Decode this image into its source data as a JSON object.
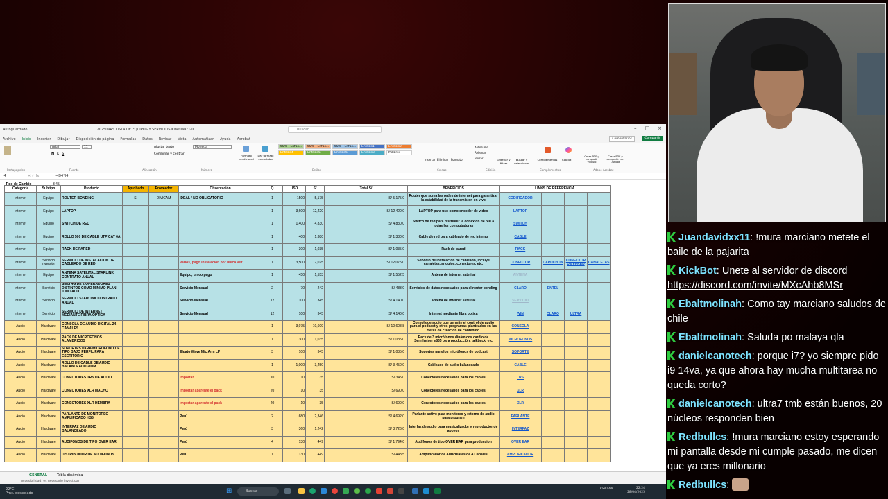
{
  "excel": {
    "autosave_label": "Autoguardado",
    "doc_title": "202509RS LISTA DE EQUIPOS Y SERVICIOS KinesiaRr GIC",
    "search_placeholder": "Buscar",
    "menu": [
      "Archivo",
      "Inicio",
      "Insertar",
      "Dibujar",
      "Disposición de página",
      "Fórmulas",
      "Datos",
      "Revisar",
      "Vista",
      "Automatizar",
      "Ayuda",
      "Acrobat"
    ],
    "comments_label": "Comentarios",
    "share_label": "Compartir",
    "ribbon": {
      "font_name": "Arial",
      "font_size": "11",
      "wrap_text": "Ajustar texto",
      "merge": "Combinar y centrar",
      "number_format": "Moneda",
      "cond_format": "Formato condicional",
      "table_format": "Dar formato como tabla",
      "styles": [
        {
          "label": "60% - Énfas...",
          "color": "#a9d08e"
        },
        {
          "label": "60% - Énfas...",
          "color": "#f4b183"
        },
        {
          "label": "60% - Énfas...",
          "color": "#9dc3e6"
        },
        {
          "label": "Énfasis1",
          "color": "#4472c4"
        },
        {
          "label": "Énfasis2",
          "color": "#ed7d31"
        },
        {
          "label": "Énfasis4",
          "color": "#ffc000"
        },
        {
          "label": "Énfasis5",
          "color": "#70ad47"
        },
        {
          "label": "Énfasis6",
          "color": "#5b9bd5"
        },
        {
          "label": "Énfasis3",
          "color": "#4bacc6"
        },
        {
          "label": "Millares",
          "color": "#ffffff"
        }
      ],
      "insert": "Insertar",
      "delete": "Eliminar",
      "format": "Formato",
      "autosum": "Autosuma",
      "fill": "Rellenar",
      "clear": "Borrar",
      "sort_filter": "Ordenar y filtrar",
      "find_select": "Buscar y seleccionar",
      "addins": "Complementos",
      "copilot": "Copilot",
      "pdf1": "Crear PDF y compartir vínculo",
      "pdf2": "Crear PDF y compartir con Outlook",
      "groups": [
        "Portapapeles",
        "Fuente",
        "Alineación",
        "Número",
        "Estilos",
        "Celdas",
        "Edición",
        "Complementos",
        "Adobe Acrobat"
      ]
    },
    "formula": {
      "cell": "I4",
      "value": "=D4*I4"
    },
    "exchange_label": "Tipo de Cambio",
    "exchange_rate": "3.45",
    "headers": [
      "Categoría",
      "Subtipo",
      "Producto",
      "Aprobado",
      "Proveedor",
      "Observación",
      "Q",
      "USD",
      "S/",
      "Total S/",
      "BENEFICIOS",
      "LINKS DE REFERENCIA"
    ],
    "rows": [
      {
        "cat": "Internet",
        "sub": "Equipo",
        "prod": "ROUTER BONDING",
        "apr": "Si",
        "prov": "DIVICAM",
        "obs": "IDEAL / NO OBLIGATORIO",
        "q": "1",
        "usd": "1500",
        "sol": "5,175",
        "total": "S/ 5,175.0",
        "ben": "Router que suma las redes de internet para garantizar la estabilidad de la transmision en vivo",
        "l1": "CODIFICADOR",
        "l2": "",
        "l3": "",
        "l4": ""
      },
      {
        "cat": "Internet",
        "sub": "Equipo",
        "prod": "LAPTOP",
        "apr": "",
        "prov": "",
        "obs": "",
        "q": "1",
        "usd": "3,600",
        "sol": "12,420",
        "total": "S/ 12,420.0",
        "ben": "LAPTOP para uso como encoder de video",
        "l1": "LAPTOP",
        "l2": "",
        "l3": "",
        "l4": ""
      },
      {
        "cat": "Internet",
        "sub": "Equipo",
        "prod": "SWITCH DE RED",
        "apr": "",
        "prov": "",
        "obs": "",
        "q": "1",
        "usd": "1,400",
        "sol": "4,830",
        "total": "S/ 4,830.0",
        "ben": "Switch de red para distribuir la conexión de red a todas las computadoras",
        "l1": "SWITCH",
        "l2": "",
        "l3": "",
        "l4": ""
      },
      {
        "cat": "Internet",
        "sub": "Equipo",
        "prod": "ROLLO 500 DE CABLE UTP CAT 6A",
        "apr": "",
        "prov": "",
        "obs": "",
        "q": "1",
        "usd": "400",
        "sol": "1,380",
        "total": "S/ 1,380.0",
        "ben": "Cable de red para cableado de red interno",
        "l1": "CABLE",
        "l2": "",
        "l3": "",
        "l4": ""
      },
      {
        "cat": "Internet",
        "sub": "Equipo",
        "prod": "RACK DE PARED",
        "apr": "",
        "prov": "",
        "obs": "",
        "q": "1",
        "usd": "300",
        "sol": "1,035",
        "total": "S/ 1,035.0",
        "ben": "Rack de pared",
        "l1": "RACK",
        "l2": "",
        "l3": "",
        "l4": ""
      },
      {
        "cat": "Internet",
        "sub": "Servicio Inversión",
        "prod": "SERVICIO DE INSTALACION DE CABLEADO DE RED",
        "apr": "",
        "prov": "",
        "obs": "Varios, pago instalacion por unica vez",
        "obs_red": true,
        "q": "1",
        "usd": "3,500",
        "sol": "12,075",
        "total": "S/ 12,075.0",
        "ben": "Servicio de instalacion de cableado, incluye canaletas, angulos, conectores, etc.",
        "l1": "CONECTOR",
        "l2": "CAPUCHON",
        "l3": "CONECTOR DE PARED",
        "l4": "CANALETAS"
      },
      {
        "cat": "Internet",
        "sub": "Equipo",
        "prod": "ANTENA SATELITAL STARLINK CONTRATO ANUAL",
        "apr": "",
        "prov": "",
        "obs": "Equipo, unico pago",
        "q": "1",
        "usd": "450",
        "sol": "1,553",
        "total": "S/ 1,552.5",
        "ben": "Antena de internet satelital",
        "l1": "ANTENA",
        "l2": "",
        "l3": "",
        "l4": "",
        "l1_faint": true
      },
      {
        "cat": "Internet",
        "sub": "Servicio",
        "prod": "SIMS 4G DE 2 OPERADORES DISTINTOS COMO MINIMO PLAN ILIMITADO",
        "apr": "",
        "prov": "",
        "obs": "Servicio Mensual",
        "q": "2",
        "usd": "70",
        "sol": "242",
        "total": "S/ 483.0",
        "ben": "Servicios de datos necesarios para el router bonding",
        "l1": "CLARO",
        "l2": "ENTEL",
        "l3": "",
        "l4": ""
      },
      {
        "cat": "Internet",
        "sub": "Servicio",
        "prod": "SERVICIO STARLINK CONTRATO ANUAL",
        "apr": "",
        "prov": "",
        "obs": "Servicio Mensual",
        "q": "12",
        "usd": "100",
        "sol": "345",
        "total": "S/ 4,140.0",
        "ben": "Antena de internet satelital",
        "l1": "SERVICIO",
        "l2": "",
        "l3": "",
        "l4": "",
        "l1_faint": true
      },
      {
        "cat": "Internet",
        "sub": "Servicio",
        "prod": "SERVICIO DE INTERNET MEDIANTE FIBRA OPTICA",
        "apr": "",
        "prov": "",
        "obs": "Servicio Mensual",
        "q": "12",
        "usd": "100",
        "sol": "345",
        "total": "S/ 4,140.0",
        "ben": "Internet mediante fibra optica",
        "l1": "WIN",
        "l2": "CLARO",
        "l3": "ULTRA",
        "l4": ""
      },
      {
        "cat": "Audio",
        "sub": "Hardware",
        "prod": "CONSOLA DE AUDIO DIGITAL 24 CANALES",
        "apr": "",
        "prov": "",
        "obs": "",
        "q": "1",
        "usd": "3,075",
        "sol": "10,609",
        "total": "S/ 10,608.8",
        "ben": "Consola de audio que permite el control de audio para el podcast y otros programas planteados en las metas de creación de contenido.",
        "l1": "CONSOLA",
        "l2": "",
        "l3": "",
        "l4": ""
      },
      {
        "cat": "Audio",
        "sub": "Hardware",
        "prod": "PACK DE MICROFONOS ALAMBRICOS",
        "apr": "",
        "prov": "",
        "obs": "",
        "q": "1",
        "usd": "300",
        "sol": "1,035",
        "total": "S/ 1,035.0",
        "ben": "Pack de 3 micrófonos dinámicos cardioide Sennheiser e835 para producción, talkback, etc",
        "l1": "MICROFONOS",
        "l2": "",
        "l3": "",
        "l4": ""
      },
      {
        "cat": "Audio",
        "sub": "Hardware",
        "prod": "SOPORTES PARA MICROFONO DE TIPO BAJO PERFIL PARA ESCRITORIO",
        "apr": "",
        "prov": "",
        "obs": "Elgato Wave Mic Arm LP",
        "q": "3",
        "usd": "100",
        "sol": "345",
        "total": "S/ 1,035.0",
        "ben": "Soportes para los micrófonos de podcast",
        "l1": "SOPORTE",
        "l2": "",
        "l3": "",
        "l4": ""
      },
      {
        "cat": "Audio",
        "sub": "Hardware",
        "prod": "ROLLO DE CABLE DE AUDIO BALANCEADO 200M",
        "apr": "",
        "prov": "",
        "obs": "",
        "q": "1",
        "usd": "1,000",
        "sol": "3,450",
        "total": "S/ 3,450.0",
        "ben": "Cableado de audio balanceado",
        "l1": "CABLE",
        "l2": "",
        "l3": "",
        "l4": ""
      },
      {
        "cat": "Audio",
        "sub": "Hardware",
        "prod": "CONECTORES TRS DE AUDIO",
        "apr": "",
        "prov": "",
        "obs": "Importar",
        "obs_red": true,
        "q": "10",
        "usd": "10",
        "sol": "35",
        "total": "S/ 345.0",
        "ben": "Conectores necesarios para los cables",
        "l1": "TRS",
        "l2": "",
        "l3": "",
        "l4": ""
      },
      {
        "cat": "Audio",
        "sub": "Hardware",
        "prod": "CONECTORES XLR MACHO",
        "apr": "",
        "prov": "",
        "obs": "importar aparente el pack",
        "obs_red": true,
        "q": "20",
        "usd": "10",
        "sol": "35",
        "total": "S/ 690.0",
        "ben": "Conectores necesarios para los cables",
        "l1": "XLR",
        "l2": "",
        "l3": "",
        "l4": ""
      },
      {
        "cat": "Audio",
        "sub": "Hardware",
        "prod": "CONECTORES XLR HEMBRA",
        "apr": "",
        "prov": "",
        "obs": "importar aparente el pack",
        "obs_red": true,
        "q": "20",
        "usd": "10",
        "sol": "35",
        "total": "S/ 690.0",
        "ben": "Conectores necesarios para los cables",
        "l1": "XLR",
        "l2": "",
        "l3": "",
        "l4": ""
      },
      {
        "cat": "Audio",
        "sub": "Hardware",
        "prod": "PARLANTE DE MONITOREO AMPLIFICADO HS5",
        "apr": "",
        "prov": "",
        "obs": "Perú",
        "q": "2",
        "usd": "680",
        "sol": "2,346",
        "total": "S/ 4,692.0",
        "ben": "Parlante activo para monitoreo y retorno de audio para program",
        "l1": "PARLANTE",
        "l2": "",
        "l3": "",
        "l4": ""
      },
      {
        "cat": "Audio",
        "sub": "Hardware",
        "prod": "INTERFAZ DE AUDIO BALANCEADO",
        "apr": "",
        "prov": "",
        "obs": "Perú",
        "q": "3",
        "usd": "360",
        "sol": "1,242",
        "total": "S/ 3,726.0",
        "ben": "Interfaz de audio para musicalizador y reproductor de apoyos",
        "l1": "INTERFAZ",
        "l2": "",
        "l3": "",
        "l4": ""
      },
      {
        "cat": "Audio",
        "sub": "Hardware",
        "prod": "AUDIFONOS DE TIPO OVER EAR",
        "apr": "",
        "prov": "",
        "obs": "Perú",
        "q": "4",
        "usd": "130",
        "sol": "449",
        "total": "S/ 1,794.0",
        "ben": "Audífonos de tipo OVER EAR para produccion",
        "l1": "OVER EAR",
        "l2": "",
        "l3": "",
        "l4": ""
      },
      {
        "cat": "Audio",
        "sub": "Hardware",
        "prod": "DISTRIBUIDOR DE AUDIFONOS",
        "apr": "",
        "prov": "",
        "obs": "Perú",
        "q": "1",
        "usd": "130",
        "sol": "449",
        "total": "S/ 448.5",
        "ben": "Amplificador de Auriculares de 4 Canales",
        "l1": "AMPLIFICADOR",
        "l2": "",
        "l3": "",
        "l4": ""
      }
    ],
    "sheet_tabs": [
      "GENERAL",
      "Tabla dinámica"
    ],
    "status": "Accesibilidad: es necesario investigar",
    "taskbar": {
      "weather_temp": "22°C",
      "weather_desc": "Prnc. despejado",
      "search": "Buscar",
      "lang": "ESP LAA",
      "time": "22:24",
      "date": "28/04/2025"
    }
  },
  "chat": [
    {
      "user": "Juandavidxx11",
      "text": "!mura marciano metete el baile de la pajarita"
    },
    {
      "user": "KickBot",
      "text": "Unete al servidor de discord",
      "link": "https://discord.com/invite/MXcAhb8MSr"
    },
    {
      "user": "Ebaltmolinah",
      "text": "Como tay marciano saludos de chile"
    },
    {
      "user": "Ebaltmolinah",
      "text": "Saluda po malaya qla"
    },
    {
      "user": "danielcanotech",
      "text": "porque i7? yo siempre pido i9 14va, ya que ahora hay mucha multitarea no queda corto?"
    },
    {
      "user": "danielcanotech",
      "text": "ultra7 tmb están buenos, 20 núcleos responden bien"
    },
    {
      "user": "Redbullcs",
      "text": "!mura marciano estoy esperando mi pantalla desde mi cumple pasado, me dicen que ya eres millonario"
    },
    {
      "user": "Redbullcs",
      "text": ""
    }
  ],
  "colors": {
    "internet_row": "#b7e1e6",
    "audio_row": "#ffe49a",
    "header_highlight": "#f4b400",
    "excel_green": "#107c41",
    "chat_badge": "#2ecc40"
  }
}
